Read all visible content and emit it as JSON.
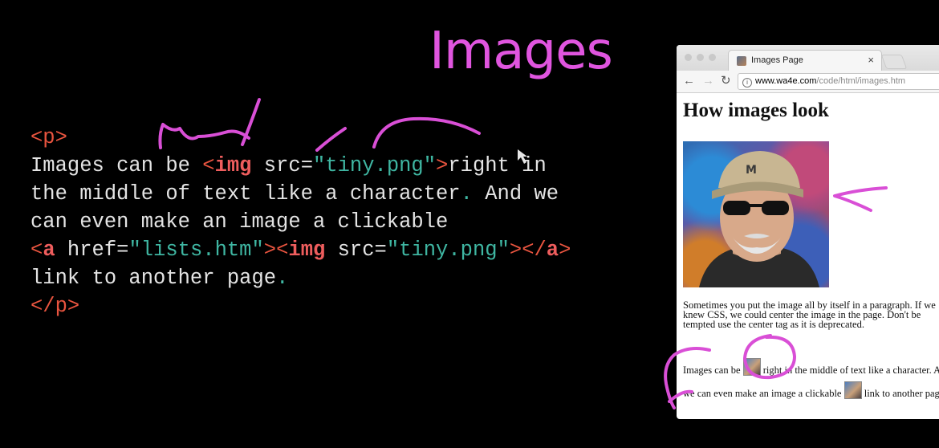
{
  "slide": {
    "title": "Images"
  },
  "code": {
    "line1": {
      "open_tag": "<p>"
    },
    "line2": {
      "text_before": "Images can be ",
      "tag_open": "<",
      "tag_name": "img",
      "attr": " src=",
      "value": "\"tiny.png\"",
      "tag_close": ">",
      "text_after": "right in"
    },
    "line3": {
      "text": "the middle of text like a character",
      "dot": ".",
      "text_after": " And we"
    },
    "line4": {
      "text": "can even make an image a clickable"
    },
    "line5": {
      "a_open": "<",
      "a_name": "a",
      "a_attr": " href=",
      "a_value": "\"lists.htm\"",
      "a_close": ">",
      "img_open": "<",
      "img_name": "img",
      "img_attr": " src=",
      "img_value": "\"tiny.png\"",
      "img_close": ">",
      "end_open": "</",
      "end_name": "a",
      "end_close": ">"
    },
    "line6": {
      "text": "link to another page",
      "dot": "."
    },
    "line7": {
      "close_tag": "</p>"
    }
  },
  "browser": {
    "tab_title": "Images Page",
    "tab_close": "×",
    "url_host": "www.wa4e.com",
    "url_path": "/code/html/images.htm",
    "page": {
      "heading": "How images look",
      "para1_line1": "Sometimes you put the image all by itself in a paragraph. If we",
      "para1_line2": "knew CSS, we could center the image in the page. Don't be",
      "para1_line3": "tempted use the center tag as it is deprecated.",
      "para2_part1": "Images can be ",
      "para2_part2": " right in the middle of text like a character. And",
      "para2_part3": "we can even make an image a clickable ",
      "para2_part4": " link to another page."
    }
  },
  "colors": {
    "title": "#e055df",
    "ink": "#d94fd6",
    "code_tag": "#e8543f",
    "code_string": "#3fb6a2",
    "code_text": "#e4e4e4"
  }
}
